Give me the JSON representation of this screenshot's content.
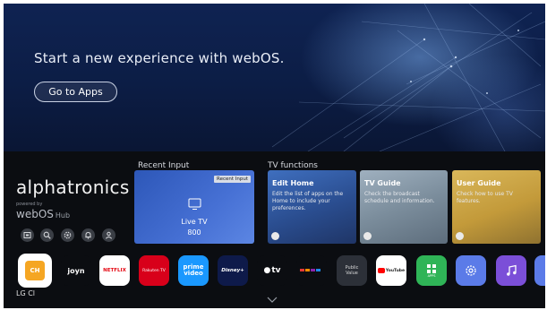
{
  "hero": {
    "title": "Start a new experience with webOS.",
    "button_label": "Go to Apps"
  },
  "brand": {
    "name": "alphatronics",
    "powered_by": "powered by",
    "webos": "webOS",
    "hub": "Hub"
  },
  "quick_buttons": [
    "input-icon",
    "search-icon",
    "settings-icon",
    "notifications-icon",
    "profile-icon"
  ],
  "sections": {
    "recent_input": "Recent Input",
    "tv_functions": "TV functions"
  },
  "recent_card": {
    "tag": "Recent Input",
    "name": "Live TV",
    "channel": "800"
  },
  "function_cards": [
    {
      "title": "Edit Home",
      "desc": "Edit the list of apps on the Home to include your preferences."
    },
    {
      "title": "TV Guide",
      "desc": "Check the broadcast schedule and information."
    },
    {
      "title": "User Guide",
      "desc": "Check how to use TV features."
    }
  ],
  "apps": {
    "lgch_label": "LG Cl",
    "joyn": "joyn",
    "netflix": "NETFLIX",
    "rakuten": "Rakuten TV",
    "prime_line1": "prime",
    "prime_line2": "video",
    "disney": "Disney+",
    "appletv": "tv",
    "public_value_line1": "Public",
    "public_value_line2": "Value",
    "youtube": "YouTube",
    "apps_label": "APPS"
  },
  "colors": {
    "accent_blue": "#2d57b8",
    "netflix_red": "#e50914",
    "rakuten_red": "#d8001a",
    "prime_blue": "#1a98ff",
    "apps_green": "#2fb457",
    "music_purple": "#7b4fd8",
    "settings_blue": "#5b7be8"
  }
}
